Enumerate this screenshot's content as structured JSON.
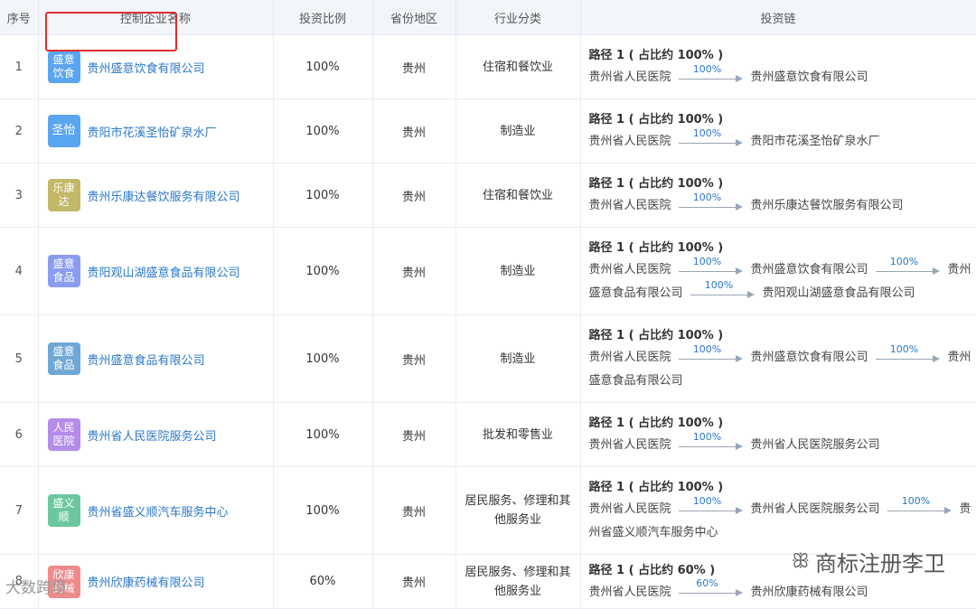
{
  "headers": {
    "idx": "序号",
    "name": "控制企业名称",
    "ratio": "投资比例",
    "region": "省份地区",
    "industry": "行业分类",
    "chain": "投资链"
  },
  "rows": [
    {
      "idx": "1",
      "logo": "盛意\n饮食",
      "logo_color": "#5aa5f0",
      "name": "贵州盛意饮食有限公司",
      "ratio": "100%",
      "region": "贵州",
      "industry": "住宿和餐饮业",
      "path": "路径 1 ( 占比约 100% )",
      "lines": [
        [
          "贵州省人民医院",
          "100%",
          "贵州盛意饮食有限公司"
        ]
      ]
    },
    {
      "idx": "2",
      "logo": "圣怡",
      "logo_color": "#5aa5f0",
      "name": "贵阳市花溪圣怡矿泉水厂",
      "ratio": "100%",
      "region": "贵州",
      "industry": "制造业",
      "path": "路径 1 ( 占比约 100% )",
      "lines": [
        [
          "贵州省人民医院",
          "100%",
          "贵阳市花溪圣怡矿泉水厂"
        ]
      ]
    },
    {
      "idx": "3",
      "logo": "乐康\n达",
      "logo_color": "#c3b768",
      "name": "贵州乐康达餐饮服务有限公司",
      "ratio": "100%",
      "region": "贵州",
      "industry": "住宿和餐饮业",
      "path": "路径 1 ( 占比约 100% )",
      "lines": [
        [
          "贵州省人民医院",
          "100%",
          "贵州乐康达餐饮服务有限公司"
        ]
      ]
    },
    {
      "idx": "4",
      "logo": "盛意\n食品",
      "logo_color": "#8b9cf0",
      "name": "贵阳观山湖盛意食品有限公司",
      "ratio": "100%",
      "region": "贵州",
      "industry": "制造业",
      "path": "路径 1 ( 占比约 100% )",
      "lines": [
        [
          "贵州省人民医院",
          "100%",
          "贵州盛意饮食有限公司",
          "100%",
          "贵州"
        ],
        [
          "盛意食品有限公司",
          "100%",
          "贵阳观山湖盛意食品有限公司"
        ]
      ]
    },
    {
      "idx": "5",
      "logo": "盛意\n食品",
      "logo_color": "#6fa8d6",
      "name": "贵州盛意食品有限公司",
      "ratio": "100%",
      "region": "贵州",
      "industry": "制造业",
      "path": "路径 1 ( 占比约 100% )",
      "lines": [
        [
          "贵州省人民医院",
          "100%",
          "贵州盛意饮食有限公司",
          "100%",
          "贵州"
        ],
        [
          "盛意食品有限公司"
        ]
      ]
    },
    {
      "idx": "6",
      "logo": "人民\n医院",
      "logo_color": "#b68cea",
      "name": "贵州省人民医院服务公司",
      "ratio": "100%",
      "region": "贵州",
      "industry": "批发和零售业",
      "path": "路径 1 ( 占比约 100% )",
      "lines": [
        [
          "贵州省人民医院",
          "100%",
          "贵州省人民医院服务公司"
        ]
      ]
    },
    {
      "idx": "7",
      "logo": "盛义\n顺",
      "logo_color": "#6cc7a0",
      "name": "贵州省盛义顺汽车服务中心",
      "ratio": "100%",
      "region": "贵州",
      "industry": "居民服务、修理和其他服务业",
      "path": "路径 1 ( 占比约 100% )",
      "lines": [
        [
          "贵州省人民医院",
          "100%",
          "贵州省人民医院服务公司",
          "100%",
          "贵"
        ],
        [
          "州省盛义顺汽车服务中心"
        ]
      ]
    },
    {
      "idx": "8",
      "logo": "欣康\n药械",
      "logo_color": "#f08a8a",
      "name": "贵州欣康药械有限公司",
      "ratio": "60%",
      "region": "贵州",
      "industry": "居民服务、修理和其他服务业",
      "path": "路径 1 ( 占比约 60% )",
      "lines": [
        [
          "贵州省人民医院",
          "60%",
          "贵州欣康药械有限公司"
        ]
      ]
    }
  ],
  "watermark": {
    "text": "商标注册李卫",
    "icon": "wechat-icon"
  },
  "watermark2": {
    "text": "大数跨境"
  }
}
